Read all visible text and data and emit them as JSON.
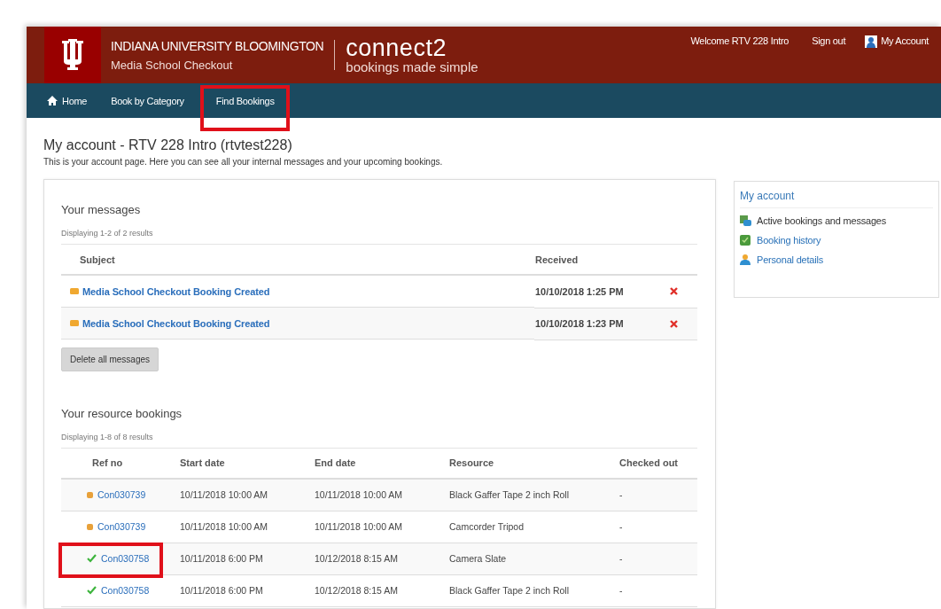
{
  "header": {
    "university": "INDIANA UNIVERSITY BLOOMINGTON",
    "department": "Media School Checkout",
    "brand": "connect2",
    "tagline": "bookings made simple",
    "links": [
      {
        "label": "Welcome RTV 228 Intro",
        "kind": "text"
      },
      {
        "label": "Sign out",
        "kind": "link"
      },
      {
        "label": "My Account",
        "kind": "account"
      }
    ]
  },
  "nav": [
    {
      "label": "Home",
      "kind": "home",
      "highlighted": false
    },
    {
      "label": "Book by Category",
      "kind": "plain",
      "highlighted": false
    },
    {
      "label": "Find Bookings",
      "kind": "plain",
      "highlighted": true
    }
  ],
  "page": {
    "title": "My account - RTV 228 Intro (rtvtest228)",
    "description": "This is your account page. Here you can see all your internal messages and your upcoming bookings."
  },
  "messages": {
    "heading": "Your messages",
    "count": "Displaying 1-2 of 2 results",
    "columns": [
      "Subject",
      "Received"
    ],
    "rows": [
      {
        "subject": "Media School Checkout Booking Created",
        "received": "10/10/2018 1:25 PM"
      },
      {
        "subject": "Media School Checkout Booking Created",
        "received": "10/10/2018 1:23 PM"
      }
    ],
    "button": "Delete all messages"
  },
  "bookings": {
    "heading": "Your resource bookings",
    "count": "Displaying 1-8 of 8 results",
    "columns": [
      "Ref no",
      "Start date",
      "End date",
      "Resource",
      "Checked out"
    ],
    "rows": [
      {
        "kind": "pending",
        "ref": "Con030739",
        "start": "10/11/2018 10:00 AM",
        "end": "10/11/2018 10:00 AM",
        "resource": "Black Gaffer Tape 2 inch Roll",
        "checked_out": "-",
        "highlighted": false
      },
      {
        "kind": "pending",
        "ref": "Con030739",
        "start": "10/11/2018 10:00 AM",
        "end": "10/11/2018 10:00 AM",
        "resource": "Camcorder Tripod",
        "checked_out": "-",
        "highlighted": false
      },
      {
        "kind": "confirmed",
        "ref": "Con030758",
        "start": "10/11/2018 6:00 PM",
        "end": "10/12/2018 8:15 AM",
        "resource": "Camera Slate",
        "checked_out": "-",
        "highlighted": true
      },
      {
        "kind": "confirmed",
        "ref": "Con030758",
        "start": "10/11/2018 6:00 PM",
        "end": "10/12/2018 8:15 AM",
        "resource": "Black Gaffer Tape 2 inch Roll",
        "checked_out": "-",
        "highlighted": false
      }
    ]
  },
  "sidebar": {
    "title": "My account",
    "items": [
      {
        "label": "Active bookings and messages",
        "kind": "active",
        "selected": true
      },
      {
        "label": "Booking history",
        "kind": "history",
        "selected": false
      },
      {
        "label": "Personal details",
        "kind": "person",
        "selected": false
      }
    ]
  }
}
